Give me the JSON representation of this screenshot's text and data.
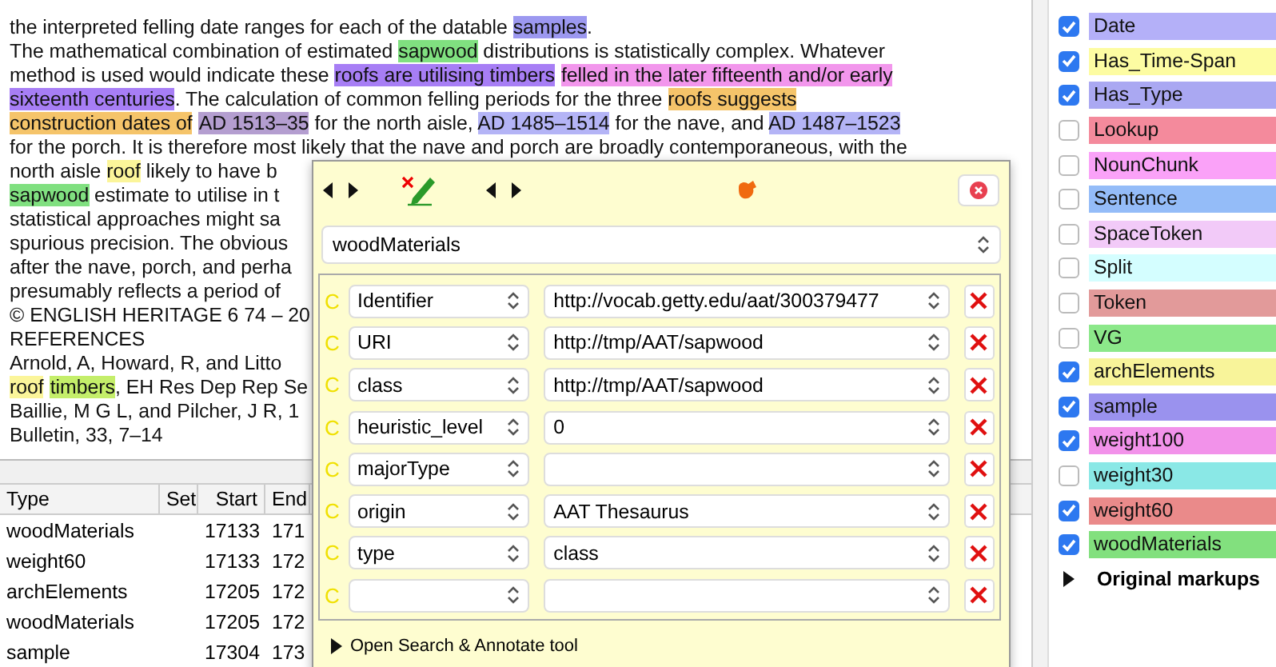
{
  "document": {
    "lines": [
      [
        {
          "text": "the interpreted felling date ranges for each of the datable "
        },
        {
          "text": "samples",
          "color": "#9c98f0"
        },
        {
          "text": "."
        }
      ],
      [
        {
          "text": "The mathematical combination of estimated "
        },
        {
          "text": "sapwood",
          "color": "#80e080"
        },
        {
          "text": " distributions is statistically complex. Whatever"
        }
      ],
      [
        {
          "text": "method is used would indicate these "
        },
        {
          "text": "roofs are utilising timbers",
          "color": "#a77ef5"
        },
        {
          "text": "felled in the later fifteenth and/or early",
          "color": "#f296ec"
        }
      ],
      [
        {
          "text": "sixteenth centuries",
          "color": "#a77ef5"
        },
        {
          "text": ". The calculation of common felling periods for the three "
        },
        {
          "text": "roofs suggests",
          "color": "#f5c46a"
        }
      ],
      [
        {
          "text": "construction dates of",
          "color": "#f5c46a"
        },
        {
          "text": "AD 1513–35",
          "color": "#b49ed0"
        },
        {
          "text": " for the north aisle, "
        },
        {
          "text": "AD 1485–1514",
          "color": "#b4b4f6"
        },
        {
          "text": " for the nave, and "
        },
        {
          "text": "AD 1487–1523",
          "color": "#b4b4f6"
        }
      ],
      [
        {
          "text": "for the porch. It is therefore most likely that the nave and porch are broadly contemporaneous, with the"
        }
      ],
      [
        {
          "text": "north aisle "
        },
        {
          "text": "roof",
          "color": "#fbf59a"
        },
        {
          "text": " likely to have b"
        }
      ],
      [
        {
          "text": "sapwood",
          "color": "#80e080"
        },
        {
          "text": " estimate to utilise in t"
        }
      ],
      [
        {
          "text": "statistical approaches might sa"
        }
      ],
      [
        {
          "text": "spurious precision. The obvious"
        }
      ],
      [
        {
          "text": "after the nave, porch, and perha"
        }
      ],
      [
        {
          "text": "presumably reflects a period of"
        }
      ],
      [
        {
          "text": "© ENGLISH HERITAGE 6 74 – 20"
        }
      ],
      [
        {
          "text": "REFERENCES"
        }
      ],
      [
        {
          "text": "Arnold, A, Howard, R, and Litto"
        }
      ],
      [
        {
          "text": "roof",
          "color": "#fbf59a"
        },
        {
          "text": "timbers",
          "color": "#c4ee6a"
        },
        {
          "text": ", EH Res Dep Rep Se"
        }
      ],
      [
        {
          "text": "Baillie, M G L, and Pilcher, J R, 1"
        }
      ],
      [
        {
          "text": "Bulletin, 33, 7–14"
        }
      ]
    ]
  },
  "annotations_table": {
    "columns": [
      "Type",
      "Set",
      "Start",
      "End"
    ],
    "rows": [
      {
        "type": "woodMaterials",
        "start": "17133",
        "end": "171"
      },
      {
        "type": "weight60",
        "start": "17133",
        "end": "172"
      },
      {
        "type": "archElements",
        "start": "17205",
        "end": "172"
      },
      {
        "type": "woodMaterials",
        "start": "17205",
        "end": "172"
      },
      {
        "type": "sample",
        "start": "17304",
        "end": "173"
      }
    ]
  },
  "editor_popup": {
    "type": "woodMaterials",
    "features": [
      {
        "marker": "C",
        "name": "Identifier",
        "value": "http://vocab.getty.edu/aat/300379477"
      },
      {
        "marker": "C",
        "name": "URI",
        "value": "http://tmp/AAT/sapwood"
      },
      {
        "marker": "C",
        "name": "class",
        "value": "http://tmp/AAT/sapwood"
      },
      {
        "marker": "C",
        "name": "heuristic_level",
        "value": "0"
      },
      {
        "marker": "C",
        "name": "majorType"
      },
      {
        "marker": "C",
        "name": "origin",
        "value": "AAT Thesaurus"
      },
      {
        "marker": "C",
        "name": "type",
        "value": "class"
      },
      {
        "marker": "C"
      }
    ],
    "footer": {
      "label": "Open Search & Annotate tool",
      "expanded": false
    }
  },
  "annotation_sets": {
    "items": [
      {
        "label": "Date",
        "checked": true,
        "color": "#b4b0f8"
      },
      {
        "label": "Has_Time-Span",
        "checked": true,
        "color": "#fdfca2"
      },
      {
        "label": "Has_Type",
        "checked": true,
        "color": "#aaa8f2"
      },
      {
        "label": "Lookup",
        "checked": false,
        "color": "#f48a9c"
      },
      {
        "label": "NounChunk",
        "checked": false,
        "color": "#faa2f8"
      },
      {
        "label": "Sentence",
        "checked": false,
        "color": "#94bcf8"
      },
      {
        "label": "SpaceToken",
        "checked": false,
        "color": "#f2caf8"
      },
      {
        "label": "Split",
        "checked": false,
        "color": "#d4feff"
      },
      {
        "label": "Token",
        "checked": false,
        "color": "#e29a9a"
      },
      {
        "label": "VG",
        "checked": false,
        "color": "#8ce88a"
      },
      {
        "label": "archElements",
        "checked": true,
        "color": "#f8f49a"
      },
      {
        "label": "sample",
        "checked": true,
        "color": "#9a92ee"
      },
      {
        "label": "weight100",
        "checked": true,
        "color": "#f292ea"
      },
      {
        "label": "weight30",
        "checked": false,
        "color": "#8ae8e6"
      },
      {
        "label": "weight60",
        "checked": true,
        "color": "#ea8a8a"
      },
      {
        "label": "woodMaterials",
        "checked": true,
        "color": "#82e07e"
      }
    ],
    "group": {
      "label": "Original markups",
      "expanded": false
    }
  }
}
